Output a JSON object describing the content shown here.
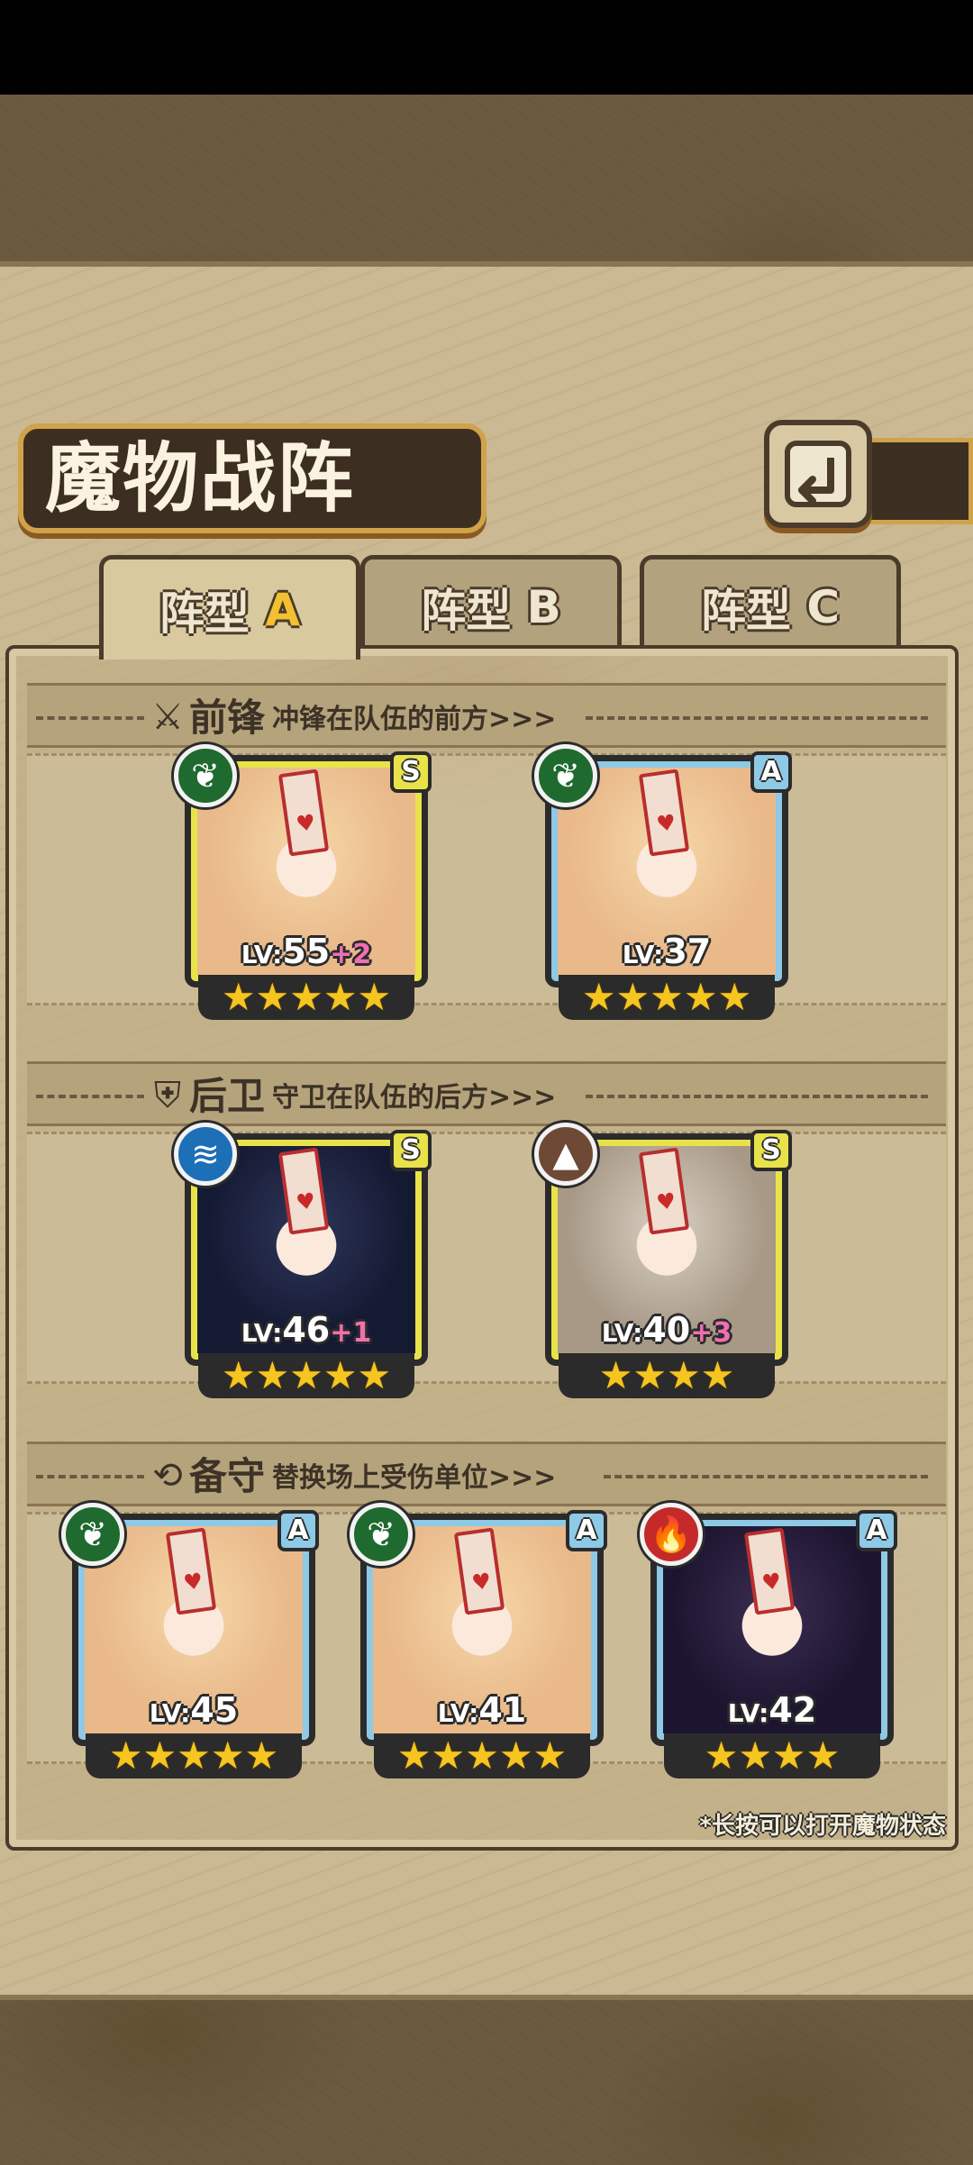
{
  "title": "魔物战阵",
  "back_icon": "back-arrow-icon",
  "tabs": [
    {
      "label": "阵型",
      "letter": "A",
      "active": true
    },
    {
      "label": "阵型",
      "letter": "B",
      "active": false
    },
    {
      "label": "阵型",
      "letter": "C",
      "active": false
    }
  ],
  "sections": {
    "front": {
      "title": "前锋",
      "desc": "冲锋在队伍的前方>>>",
      "icon": "sword-icon"
    },
    "rear": {
      "title": "后卫",
      "desc": "守卫在队伍的后方>>>",
      "icon": "shield-icon"
    },
    "reserve": {
      "title": "备守",
      "desc": "替换场上受伤单位>>>",
      "icon": "swap-icon"
    }
  },
  "cards": {
    "front": [
      {
        "rank": "S",
        "element": "grass-element-icon",
        "level_label": "LV:",
        "level": "55",
        "bonus": "+2",
        "stars": 5
      },
      {
        "rank": "A",
        "element": "grass-element-icon",
        "level_label": "LV:",
        "level": "37",
        "bonus": "",
        "stars": 5
      }
    ],
    "rear": [
      {
        "rank": "S",
        "element": "water-element-icon",
        "level_label": "LV:",
        "level": "46",
        "bonus": "+1",
        "stars": 5
      },
      {
        "rank": "S",
        "element": "earth-element-icon",
        "level_label": "LV:",
        "level": "40",
        "bonus": "+3",
        "stars": 4
      }
    ],
    "reserve": [
      {
        "rank": "A",
        "element": "grass-element-icon",
        "level_label": "LV:",
        "level": "45",
        "bonus": "",
        "stars": 5
      },
      {
        "rank": "A",
        "element": "grass-element-icon",
        "level_label": "LV:",
        "level": "41",
        "bonus": "",
        "stars": 5
      },
      {
        "rank": "A",
        "element": "fire-element-icon",
        "level_label": "LV:",
        "level": "42",
        "bonus": "",
        "stars": 4
      }
    ]
  },
  "footer_note": "*长按可以打开魔物状态",
  "colors": {
    "rank_s": "#e9e34a",
    "rank_a": "#8ec9e6",
    "star": "#f5c520",
    "bonus": "#f06fb2"
  }
}
